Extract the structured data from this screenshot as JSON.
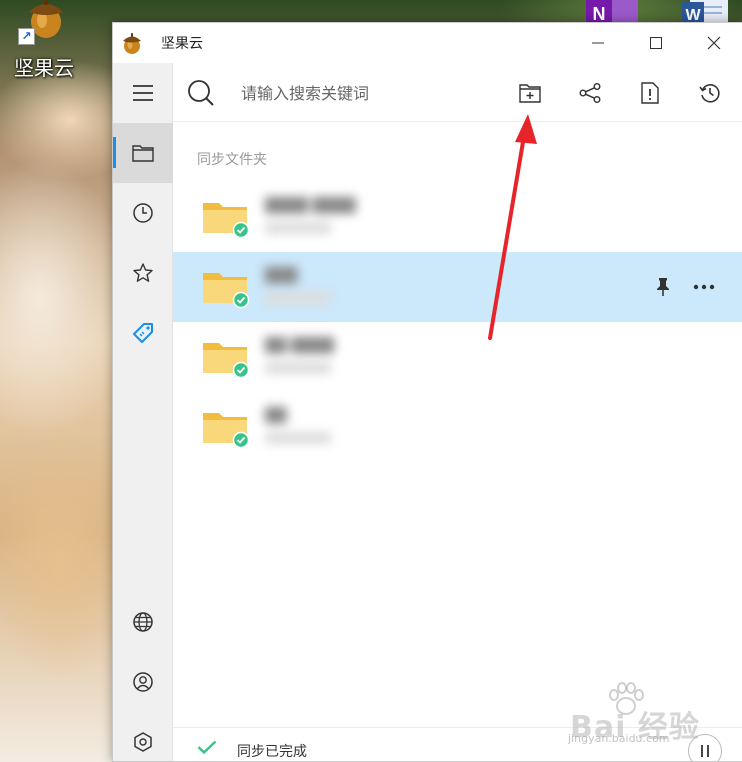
{
  "desktop": {
    "shortcut_label": "坚果云",
    "shortcut_badge": "↗",
    "onenote_letter": "N",
    "word_letter": "W"
  },
  "window": {
    "title": "坚果云"
  },
  "toolbar": {
    "search_placeholder": "请输入搜索关键词"
  },
  "content": {
    "section_title": "同步文件夹",
    "folders": [
      {
        "name": "████ ████"
      },
      {
        "name": "███"
      },
      {
        "name": "██ ████"
      },
      {
        "name": "██"
      }
    ]
  },
  "status": {
    "text": "同步已完成"
  },
  "watermark": {
    "text": "Bai 经验",
    "url": "jingyan.baidu.com"
  },
  "colors": {
    "accent": "#1c8ee8",
    "selected_row": "#cce8fb",
    "folder": "#f7cf6b",
    "sync_ok": "#35c58a",
    "arrow": "#e8242b"
  }
}
